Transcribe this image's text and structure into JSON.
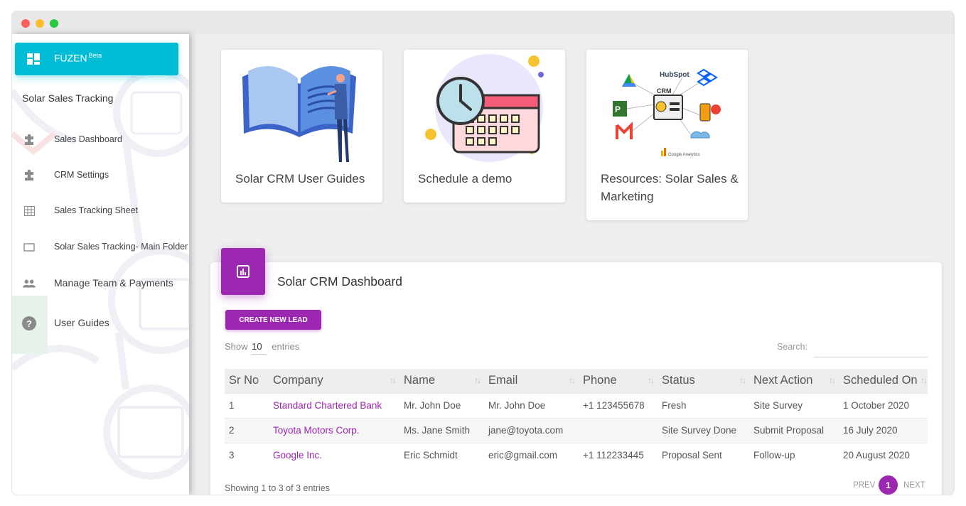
{
  "window": {
    "controls": [
      "close",
      "minimize",
      "maximize"
    ]
  },
  "sidebar": {
    "brand": "FUZEN",
    "brand_badge": "Beta",
    "app_title": "Solar Sales Tracking",
    "items": [
      {
        "label": "Sales Dashboard",
        "icon": "puzzle-icon"
      },
      {
        "label": "CRM Settings",
        "icon": "puzzle-icon"
      },
      {
        "label": "Sales Tracking Sheet",
        "icon": "grid-icon"
      },
      {
        "label": "Solar Sales Tracking- Main Folder",
        "icon": "folder-icon"
      },
      {
        "label": "Manage Team & Payments",
        "icon": "people-icon"
      },
      {
        "label": "User Guides",
        "icon": "help-icon"
      }
    ]
  },
  "cards": [
    {
      "title": "Solar CRM User Guides",
      "image": "book-illustration"
    },
    {
      "title": "Schedule a demo",
      "image": "calendar-clock-illustration"
    },
    {
      "title": "Resources: Solar Sales & Marketing",
      "image": "crm-integrations-illustration",
      "logos": [
        "HubSpot",
        "CRM",
        "Google Analytics"
      ]
    }
  ],
  "dashboard": {
    "title": "Solar CRM Dashboard",
    "create_button": "CREATE NEW LEAD",
    "show_prefix": "Show",
    "page_length": "10",
    "show_suffix": "entries",
    "search_label": "Search:",
    "search_value": "",
    "columns": [
      "Sr No",
      "Company",
      "Name",
      "Email",
      "Phone",
      "Status",
      "Next Action",
      "Scheduled On"
    ],
    "rows": [
      {
        "sr": "1",
        "company": "Standard Chartered Bank",
        "name": "Mr. John Doe",
        "email": "Mr. John Doe",
        "phone": "+1 123455678",
        "status": "Fresh",
        "next_action": "Site Survey",
        "scheduled_on": "1 October 2020"
      },
      {
        "sr": "2",
        "company": "Toyota Motors Corp.",
        "name": "Ms. Jane Smith",
        "email": "jane@toyota.com",
        "phone": "",
        "status": "Site Survey Done",
        "next_action": "Submit Proposal",
        "scheduled_on": "16 July 2020"
      },
      {
        "sr": "3",
        "company": "Google Inc.",
        "name": "Eric Schmidt",
        "email": "eric@gmail.com",
        "phone": "+1 112233445",
        "status": "Proposal Sent",
        "next_action": "Follow-up",
        "scheduled_on": "20 August 2020"
      }
    ],
    "info": "Showing 1 to 3 of 3 entries",
    "pagination": {
      "prev": "PREV",
      "current": "1",
      "next": "NEXT"
    }
  },
  "colors": {
    "brand": "#00bcd4",
    "accent": "#9c27b0",
    "background": "#eeeeee"
  }
}
